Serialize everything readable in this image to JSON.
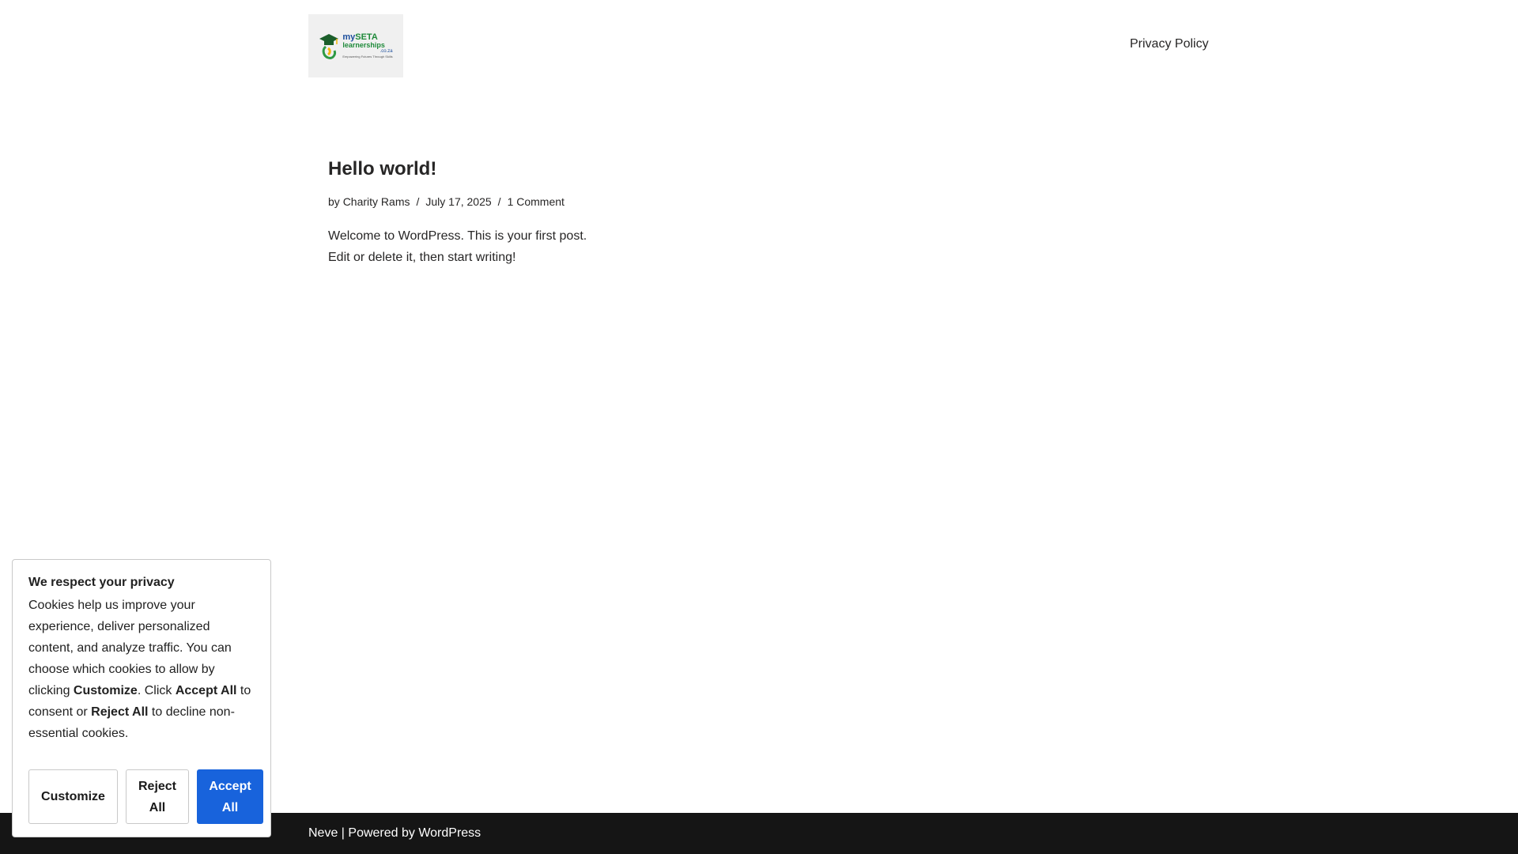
{
  "header": {
    "logo": {
      "line1_a": "my",
      "line1_b": "SETA",
      "line2": "learnerships",
      "line3": ".co.za",
      "tagline": "Empowering Futures Through Skills"
    },
    "nav": {
      "privacy_policy": "Privacy Policy"
    }
  },
  "post": {
    "title": "Hello world!",
    "meta": {
      "by": "by",
      "author": "Charity Rams",
      "separator": "/",
      "date": "July 17, 2025",
      "comments": "1 Comment"
    },
    "excerpt": "Welcome to WordPress. This is your first post. Edit or delete it, then start writing!"
  },
  "footer": {
    "theme": "Neve",
    "separator": " | Powered by ",
    "platform": "WordPress"
  },
  "cookie_banner": {
    "title": "We respect your privacy",
    "desc_1": "Cookies help us improve your experience, deliver personalized content, and analyze traffic. You can choose which cookies to allow by clicking ",
    "desc_customize": "Customize",
    "desc_2": ". Click ",
    "desc_accept": "Accept All",
    "desc_3": " to consent or ",
    "desc_reject": "Reject All",
    "desc_4": " to decline non-essential cookies.",
    "buttons": {
      "customize": "Customize",
      "reject": "Reject All",
      "accept": "Accept All"
    }
  },
  "colors": {
    "accent_blue": "#1863dc",
    "footer_bg": "#151515",
    "text": "#272626"
  }
}
